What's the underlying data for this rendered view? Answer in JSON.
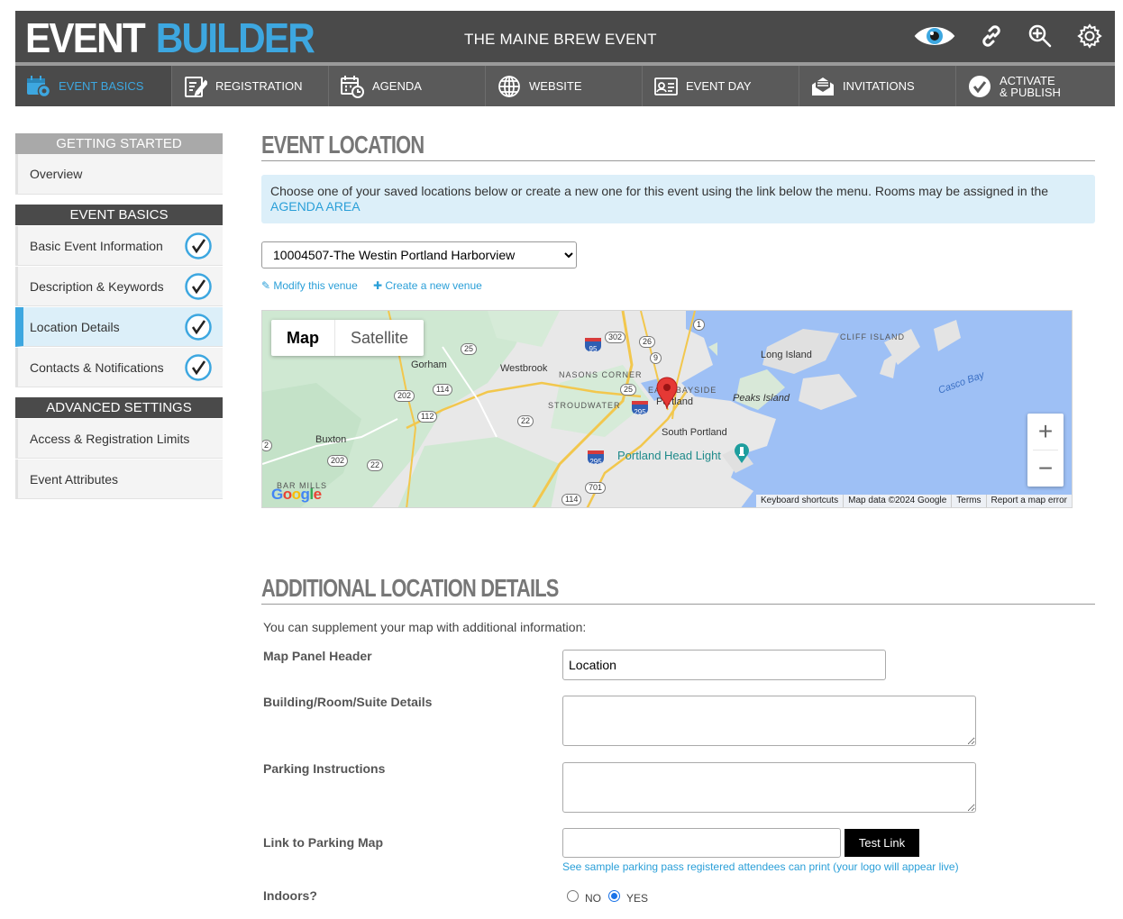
{
  "header": {
    "logo_part1": "EVENT",
    "logo_part2": "BUILDER",
    "event_title": "THE MAINE BREW EVENT",
    "icons": [
      "preview-eye-icon",
      "link-icon",
      "zoom-search-icon",
      "settings-gear-icon"
    ]
  },
  "nav": {
    "tabs": [
      {
        "label": "EVENT BASICS",
        "icon": "calendar-gear-icon",
        "active": true
      },
      {
        "label": "REGISTRATION",
        "icon": "form-edit-icon"
      },
      {
        "label": "AGENDA",
        "icon": "calendar-clock-icon"
      },
      {
        "label": "WEBSITE",
        "icon": "globe-icon"
      },
      {
        "label": "EVENT DAY",
        "icon": "badge-icon"
      },
      {
        "label": "INVITATIONS",
        "icon": "envelope-icon"
      },
      {
        "label_line1": "ACTIVATE",
        "label_line2": "& PUBLISH",
        "icon": "checkmark-circle-icon"
      }
    ]
  },
  "sidebar": {
    "getting_started": {
      "heading": "GETTING STARTED",
      "items": [
        "Overview"
      ]
    },
    "event_basics": {
      "heading": "EVENT BASICS",
      "items": [
        "Basic Event Information",
        "Description & Keywords",
        "Location Details",
        "Contacts & Notifications"
      ],
      "selected": "Location Details"
    },
    "advanced": {
      "heading": "ADVANCED SETTINGS",
      "items": [
        "Access & Registration Limits",
        "Event Attributes"
      ]
    }
  },
  "location": {
    "title": "EVENT LOCATION",
    "info_text": "Choose one of your saved locations below or create a new one for this event using the link below the menu. Rooms may be assigned in the",
    "info_link": "AGENDA AREA",
    "selected_venue": "10004507-The Westin Portland Harborview",
    "modify_link": "✎ Modify this venue",
    "create_link": "✚ Create a new venue"
  },
  "map": {
    "type_map": "Map",
    "type_satellite": "Satellite",
    "zoom_in": "+",
    "zoom_out": "−",
    "footer": [
      "Keyboard shortcuts",
      "Map data ©2024 Google",
      "Terms",
      "Report a map error"
    ],
    "google_logo": "Google",
    "places": {
      "gorham": "Gorham",
      "westbrook": "Westbrook",
      "nasons_corner": "NASONS CORNER",
      "stroudwater": "STROUDWATER",
      "east_bayside": "EAST BAYSIDE",
      "portland": "Portland",
      "south_portland": "South Portland",
      "portland_head_light": "Portland Head Light",
      "long_island": "Long Island",
      "cliff_island": "CLIFF ISLAND",
      "peaks_island": "Peaks Island",
      "casco_bay": "Casco Bay",
      "buxton": "Buxton",
      "bar_mills": "BAR MILLS"
    },
    "routes": {
      "r25a": "25",
      "r302": "302",
      "r26": "26",
      "r9": "9",
      "r1": "1",
      "r202a": "202",
      "r114a": "114",
      "r112": "112",
      "r25b": "25",
      "r22a": "22",
      "r202b": "202",
      "r22b": "22",
      "r114b": "114",
      "r701": "701",
      "r2": "2",
      "i95": "95",
      "i295a": "295",
      "i295b": "295"
    }
  },
  "additional": {
    "title": "ADDITIONAL LOCATION DETAILS",
    "supplement_text": "You can supplement your map with additional information:",
    "map_panel_header_label": "Map Panel Header",
    "map_panel_header_value": "Location",
    "building_label": "Building/Room/Suite Details",
    "building_value": "",
    "parking_label": "Parking Instructions",
    "parking_value": "",
    "parking_map_label": "Link to Parking Map",
    "parking_map_value": "",
    "test_link_button": "Test Link",
    "parking_hint": "See sample parking pass registered attendees can print (your logo will appear live)",
    "indoors_label": "Indoors?",
    "indoors_no": "NO",
    "indoors_yes": "YES",
    "indoors_selected": "YES"
  },
  "colors": {
    "accent": "#3da7e0",
    "header_bg": "#4a4a4a",
    "nav_bg": "#5a5a5a",
    "info_bg": "#dceff9"
  }
}
